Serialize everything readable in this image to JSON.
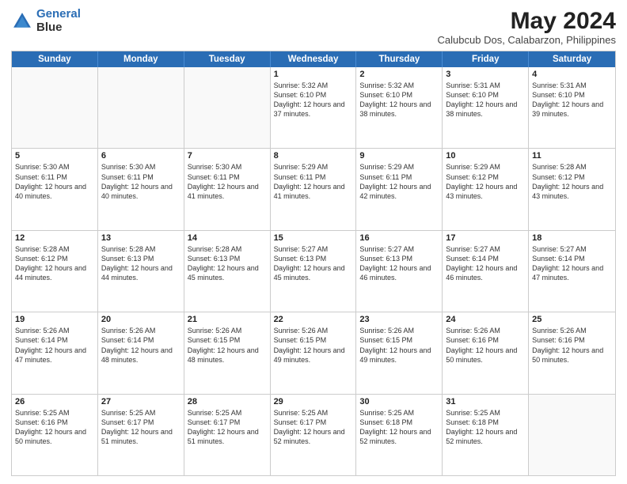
{
  "brand": {
    "line1": "General",
    "line2": "Blue"
  },
  "title": "May 2024",
  "subtitle": "Calubcub Dos, Calabarzon, Philippines",
  "days": [
    "Sunday",
    "Monday",
    "Tuesday",
    "Wednesday",
    "Thursday",
    "Friday",
    "Saturday"
  ],
  "weeks": [
    [
      {
        "day": "",
        "sunrise": "",
        "sunset": "",
        "daylight": "",
        "shaded": true
      },
      {
        "day": "",
        "sunrise": "",
        "sunset": "",
        "daylight": "",
        "shaded": true
      },
      {
        "day": "",
        "sunrise": "",
        "sunset": "",
        "daylight": "",
        "shaded": true
      },
      {
        "day": "1",
        "sunrise": "Sunrise: 5:32 AM",
        "sunset": "Sunset: 6:10 PM",
        "daylight": "Daylight: 12 hours and 37 minutes.",
        "shaded": false
      },
      {
        "day": "2",
        "sunrise": "Sunrise: 5:32 AM",
        "sunset": "Sunset: 6:10 PM",
        "daylight": "Daylight: 12 hours and 38 minutes.",
        "shaded": false
      },
      {
        "day": "3",
        "sunrise": "Sunrise: 5:31 AM",
        "sunset": "Sunset: 6:10 PM",
        "daylight": "Daylight: 12 hours and 38 minutes.",
        "shaded": false
      },
      {
        "day": "4",
        "sunrise": "Sunrise: 5:31 AM",
        "sunset": "Sunset: 6:10 PM",
        "daylight": "Daylight: 12 hours and 39 minutes.",
        "shaded": false
      }
    ],
    [
      {
        "day": "5",
        "sunrise": "Sunrise: 5:30 AM",
        "sunset": "Sunset: 6:11 PM",
        "daylight": "Daylight: 12 hours and 40 minutes.",
        "shaded": false
      },
      {
        "day": "6",
        "sunrise": "Sunrise: 5:30 AM",
        "sunset": "Sunset: 6:11 PM",
        "daylight": "Daylight: 12 hours and 40 minutes.",
        "shaded": false
      },
      {
        "day": "7",
        "sunrise": "Sunrise: 5:30 AM",
        "sunset": "Sunset: 6:11 PM",
        "daylight": "Daylight: 12 hours and 41 minutes.",
        "shaded": false
      },
      {
        "day": "8",
        "sunrise": "Sunrise: 5:29 AM",
        "sunset": "Sunset: 6:11 PM",
        "daylight": "Daylight: 12 hours and 41 minutes.",
        "shaded": false
      },
      {
        "day": "9",
        "sunrise": "Sunrise: 5:29 AM",
        "sunset": "Sunset: 6:11 PM",
        "daylight": "Daylight: 12 hours and 42 minutes.",
        "shaded": false
      },
      {
        "day": "10",
        "sunrise": "Sunrise: 5:29 AM",
        "sunset": "Sunset: 6:12 PM",
        "daylight": "Daylight: 12 hours and 43 minutes.",
        "shaded": false
      },
      {
        "day": "11",
        "sunrise": "Sunrise: 5:28 AM",
        "sunset": "Sunset: 6:12 PM",
        "daylight": "Daylight: 12 hours and 43 minutes.",
        "shaded": false
      }
    ],
    [
      {
        "day": "12",
        "sunrise": "Sunrise: 5:28 AM",
        "sunset": "Sunset: 6:12 PM",
        "daylight": "Daylight: 12 hours and 44 minutes.",
        "shaded": false
      },
      {
        "day": "13",
        "sunrise": "Sunrise: 5:28 AM",
        "sunset": "Sunset: 6:13 PM",
        "daylight": "Daylight: 12 hours and 44 minutes.",
        "shaded": false
      },
      {
        "day": "14",
        "sunrise": "Sunrise: 5:28 AM",
        "sunset": "Sunset: 6:13 PM",
        "daylight": "Daylight: 12 hours and 45 minutes.",
        "shaded": false
      },
      {
        "day": "15",
        "sunrise": "Sunrise: 5:27 AM",
        "sunset": "Sunset: 6:13 PM",
        "daylight": "Daylight: 12 hours and 45 minutes.",
        "shaded": false
      },
      {
        "day": "16",
        "sunrise": "Sunrise: 5:27 AM",
        "sunset": "Sunset: 6:13 PM",
        "daylight": "Daylight: 12 hours and 46 minutes.",
        "shaded": false
      },
      {
        "day": "17",
        "sunrise": "Sunrise: 5:27 AM",
        "sunset": "Sunset: 6:14 PM",
        "daylight": "Daylight: 12 hours and 46 minutes.",
        "shaded": false
      },
      {
        "day": "18",
        "sunrise": "Sunrise: 5:27 AM",
        "sunset": "Sunset: 6:14 PM",
        "daylight": "Daylight: 12 hours and 47 minutes.",
        "shaded": false
      }
    ],
    [
      {
        "day": "19",
        "sunrise": "Sunrise: 5:26 AM",
        "sunset": "Sunset: 6:14 PM",
        "daylight": "Daylight: 12 hours and 47 minutes.",
        "shaded": false
      },
      {
        "day": "20",
        "sunrise": "Sunrise: 5:26 AM",
        "sunset": "Sunset: 6:14 PM",
        "daylight": "Daylight: 12 hours and 48 minutes.",
        "shaded": false
      },
      {
        "day": "21",
        "sunrise": "Sunrise: 5:26 AM",
        "sunset": "Sunset: 6:15 PM",
        "daylight": "Daylight: 12 hours and 48 minutes.",
        "shaded": false
      },
      {
        "day": "22",
        "sunrise": "Sunrise: 5:26 AM",
        "sunset": "Sunset: 6:15 PM",
        "daylight": "Daylight: 12 hours and 49 minutes.",
        "shaded": false
      },
      {
        "day": "23",
        "sunrise": "Sunrise: 5:26 AM",
        "sunset": "Sunset: 6:15 PM",
        "daylight": "Daylight: 12 hours and 49 minutes.",
        "shaded": false
      },
      {
        "day": "24",
        "sunrise": "Sunrise: 5:26 AM",
        "sunset": "Sunset: 6:16 PM",
        "daylight": "Daylight: 12 hours and 50 minutes.",
        "shaded": false
      },
      {
        "day": "25",
        "sunrise": "Sunrise: 5:26 AM",
        "sunset": "Sunset: 6:16 PM",
        "daylight": "Daylight: 12 hours and 50 minutes.",
        "shaded": false
      }
    ],
    [
      {
        "day": "26",
        "sunrise": "Sunrise: 5:25 AM",
        "sunset": "Sunset: 6:16 PM",
        "daylight": "Daylight: 12 hours and 50 minutes.",
        "shaded": false
      },
      {
        "day": "27",
        "sunrise": "Sunrise: 5:25 AM",
        "sunset": "Sunset: 6:17 PM",
        "daylight": "Daylight: 12 hours and 51 minutes.",
        "shaded": false
      },
      {
        "day": "28",
        "sunrise": "Sunrise: 5:25 AM",
        "sunset": "Sunset: 6:17 PM",
        "daylight": "Daylight: 12 hours and 51 minutes.",
        "shaded": false
      },
      {
        "day": "29",
        "sunrise": "Sunrise: 5:25 AM",
        "sunset": "Sunset: 6:17 PM",
        "daylight": "Daylight: 12 hours and 52 minutes.",
        "shaded": false
      },
      {
        "day": "30",
        "sunrise": "Sunrise: 5:25 AM",
        "sunset": "Sunset: 6:18 PM",
        "daylight": "Daylight: 12 hours and 52 minutes.",
        "shaded": false
      },
      {
        "day": "31",
        "sunrise": "Sunrise: 5:25 AM",
        "sunset": "Sunset: 6:18 PM",
        "daylight": "Daylight: 12 hours and 52 minutes.",
        "shaded": false
      },
      {
        "day": "",
        "sunrise": "",
        "sunset": "",
        "daylight": "",
        "shaded": true
      }
    ]
  ]
}
